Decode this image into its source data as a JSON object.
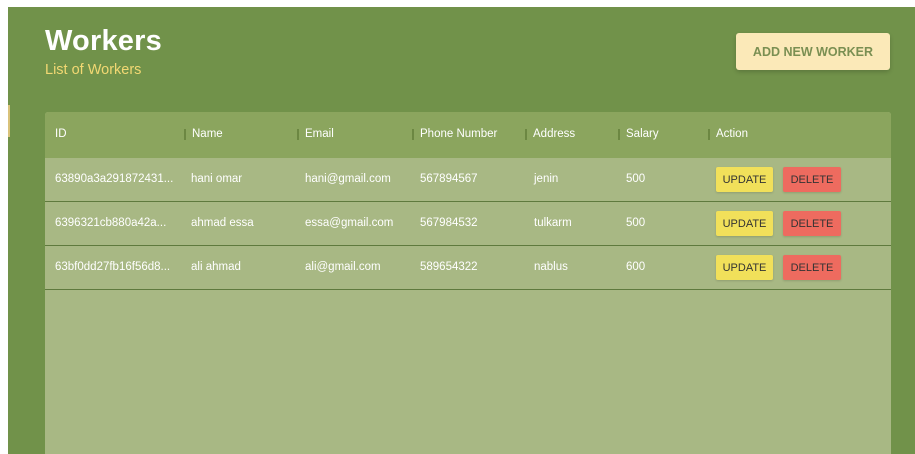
{
  "header": {
    "title": "Workers",
    "subtitle": "List of Workers",
    "add_button": "ADD NEW WORKER"
  },
  "table": {
    "columns": [
      "ID",
      "Name",
      "Email",
      "Phone Number",
      "Address",
      "Salary",
      "Action"
    ],
    "rows": [
      {
        "id": "63890a3a291872431...",
        "name": "hani omar",
        "email": "hani@gmail.com",
        "phone": "567894567",
        "address": "jenin",
        "salary": "500"
      },
      {
        "id": "6396321cb880a42a...",
        "name": "ahmad essa",
        "email": "essa@gmail.com",
        "phone": "567984532",
        "address": "tulkarm",
        "salary": "500"
      },
      {
        "id": "63bf0dd27fb16f56d8...",
        "name": "ali ahmad",
        "email": "ali@gmail.com",
        "phone": "589654322",
        "address": "nablus",
        "salary": "600"
      }
    ],
    "update_label": "UPDATE",
    "delete_label": "DELETE"
  },
  "colors": {
    "background": "#71924a",
    "header_row": "#8ba55e",
    "grid_body": "#a8b884",
    "subtitle": "#f2d873",
    "add_button": "#fbe9b8",
    "update_button": "#f1e05a",
    "delete_button": "#ee6b5f"
  }
}
